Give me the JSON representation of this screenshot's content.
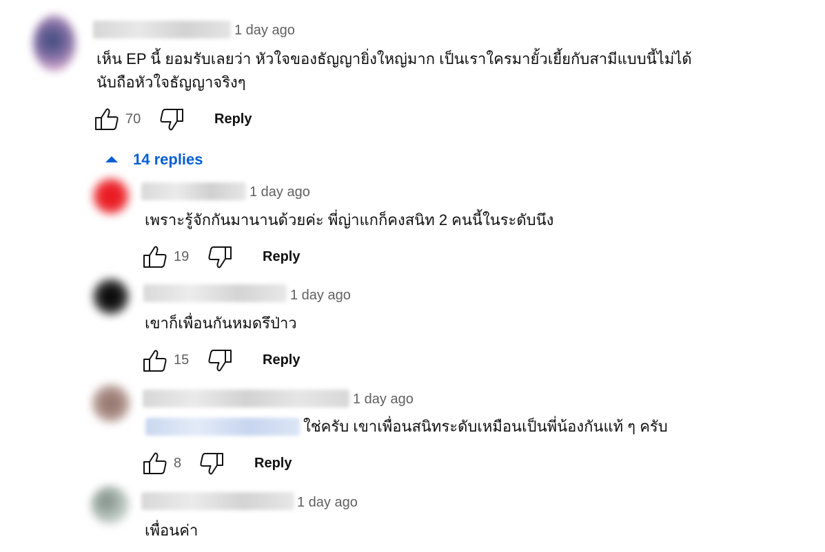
{
  "comment": {
    "time": "1 day ago",
    "text_line1": "เห็น EP นี้ ยอมรับเลยว่า หัวใจของธัญญายิ่งใหญ่มาก เป็นเราใครมายั้วเยี้ยกับสามีแบบนี้ไม่ได้",
    "text_line2": "นับถือหัวใจธัญญาจริงๆ",
    "likes": "70",
    "reply_label": "Reply"
  },
  "replies_toggle": {
    "label": "14 replies",
    "icon": "caret-up-icon",
    "color": "#065fd4"
  },
  "replies": [
    {
      "time": "1 day ago",
      "text": "เพราะรู้จักกันมานานด้วยค่ะ พี่ญ่าแกก็คงสนิท 2 คนนี้ในระดับนึง",
      "likes": "19",
      "reply_label": "Reply"
    },
    {
      "time": "1 day ago",
      "text": "เขาก็เพื่อนกันหมดรึป่าว",
      "likes": "15",
      "reply_label": "Reply"
    },
    {
      "time": "1 day ago",
      "text": "ใช่ครับ เขาเพื่อนสนิทระดับเหมือนเป็นพี่น้องกันแท้ ๆ ครับ",
      "likes": "8",
      "reply_label": "Reply"
    },
    {
      "time": "1 day ago",
      "text": "เพื่อนค่า"
    }
  ]
}
